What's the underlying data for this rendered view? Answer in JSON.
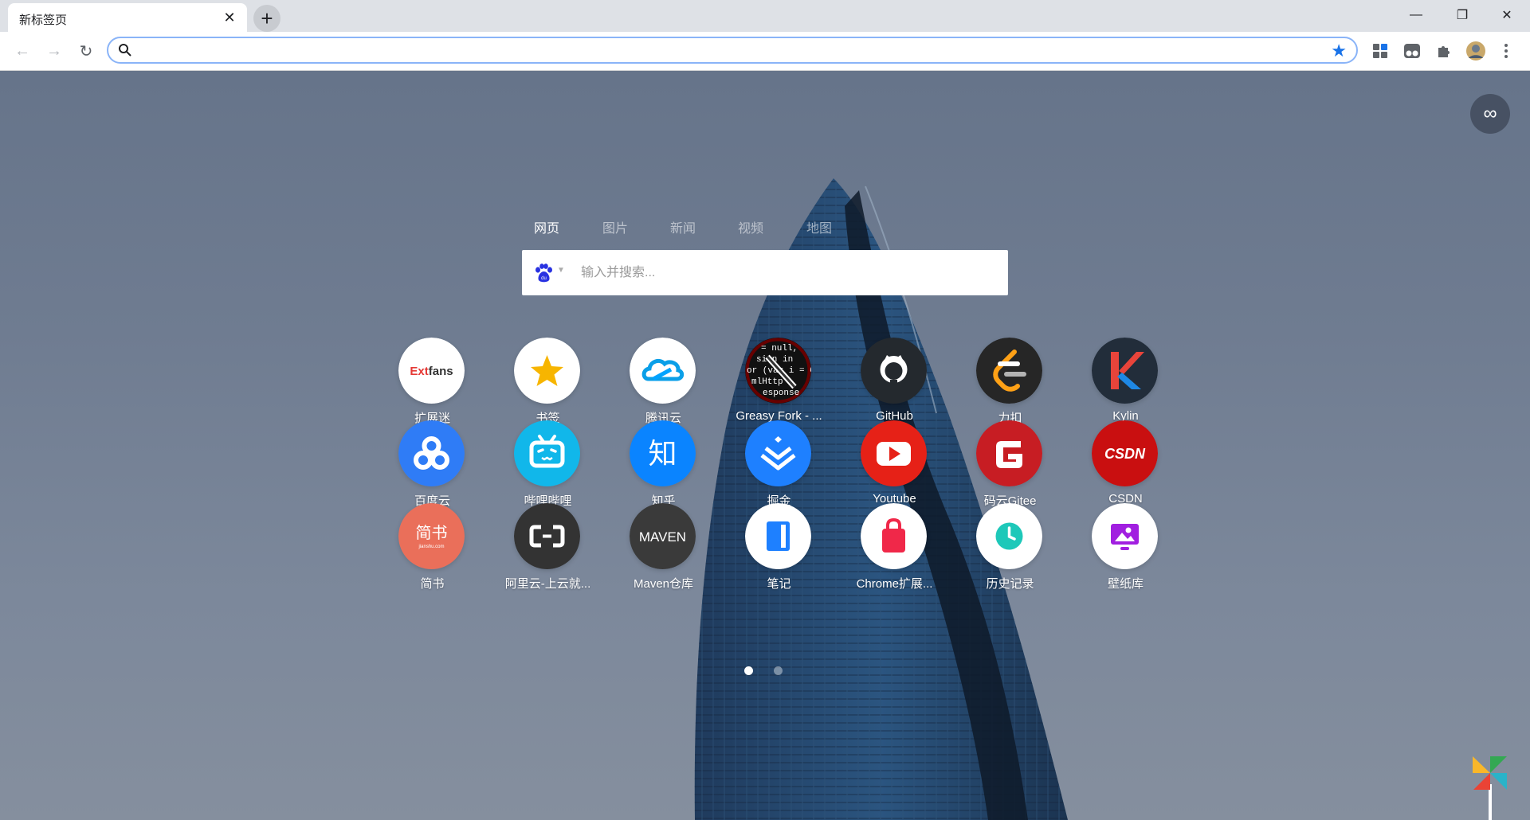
{
  "browser": {
    "tab_title": "新标签页",
    "tab_close": "✕",
    "new_tab": "+",
    "window_controls": {
      "minimize": "—",
      "restore": "❐",
      "close": "✕"
    },
    "nav": {
      "back": "←",
      "forward": "→",
      "reload": "↻"
    },
    "omnibox_value": "",
    "bookmark_star": "★"
  },
  "newtab": {
    "search_tabs": [
      "网页",
      "图片",
      "新闻",
      "视频",
      "地图"
    ],
    "active_search_tab": "网页",
    "search_placeholder": "输入并搜索...",
    "infinity_icon": "∞",
    "tiles": [
      {
        "label": "扩展迷",
        "icon": "extfans-logo"
      },
      {
        "label": "书签",
        "icon": "bookmark-star-icon"
      },
      {
        "label": "腾讯云",
        "icon": "tencent-cloud-logo"
      },
      {
        "label": "Greasy Fork - ...",
        "icon": "greasyfork-logo"
      },
      {
        "label": "GitHub",
        "icon": "github-logo"
      },
      {
        "label": "力扣",
        "icon": "leetcode-logo"
      },
      {
        "label": "Kylin",
        "icon": "kylin-logo"
      },
      {
        "label": "百度云",
        "icon": "baidu-cloud-logo"
      },
      {
        "label": "哔哩哔哩",
        "icon": "bilibili-logo"
      },
      {
        "label": "知乎",
        "icon": "zhihu-logo"
      },
      {
        "label": "掘金",
        "icon": "juejin-logo"
      },
      {
        "label": "Youtube",
        "icon": "youtube-logo"
      },
      {
        "label": "码云Gitee",
        "icon": "gitee-logo"
      },
      {
        "label": "CSDN",
        "icon": "csdn-logo"
      },
      {
        "label": "简书",
        "icon": "jianshu-logo"
      },
      {
        "label": "阿里云-上云就...",
        "icon": "aliyun-logo"
      },
      {
        "label": "Maven仓库",
        "icon": "maven-logo"
      },
      {
        "label": "笔记",
        "icon": "notes-icon"
      },
      {
        "label": "Chrome扩展...",
        "icon": "chrome-store-icon"
      },
      {
        "label": "历史记录",
        "icon": "history-icon"
      },
      {
        "label": "壁纸库",
        "icon": "wallpaper-icon"
      }
    ],
    "tile_logo_text": {
      "extfans": "Extfans",
      "zhihu": "知",
      "csdn": "CSDN",
      "jianshu": "简书",
      "jianshu_sub": "jianshu.com",
      "maven": "MAVEN",
      "greasyfork": [
        "= null,",
        "sion in",
        "or (var i = 0",
        "mlHttp",
        "esponse"
      ]
    },
    "pagination": {
      "pages": 2,
      "current": 1
    }
  },
  "colors": {
    "accent": "#1a73e8",
    "baidu": "#2932e1",
    "youtube": "#e62117",
    "gitee": "#c71d23",
    "csdn": "#c90f10",
    "jianshu": "#ea6f5a"
  }
}
